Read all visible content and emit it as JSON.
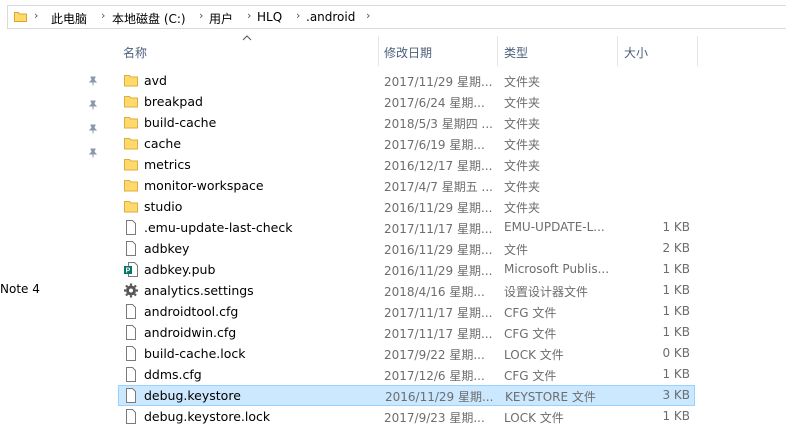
{
  "breadcrumb": [
    "此电脑",
    "本地磁盘 (C:)",
    "用户",
    "HLQ",
    ".android"
  ],
  "nav": {
    "partial_item": "Note 4"
  },
  "columns": {
    "name": "名称",
    "date": "修改日期",
    "type": "类型",
    "size": "大小"
  },
  "files": [
    {
      "name": "avd",
      "date": "2017/11/29 星期...",
      "type": "文件夹",
      "size": "",
      "icon": "folder-icon"
    },
    {
      "name": "breakpad",
      "date": "2017/6/24 星期...",
      "type": "文件夹",
      "size": "",
      "icon": "folder-icon"
    },
    {
      "name": "build-cache",
      "date": "2018/5/3 星期四 ...",
      "type": "文件夹",
      "size": "",
      "icon": "folder-icon"
    },
    {
      "name": "cache",
      "date": "2017/6/19 星期...",
      "type": "文件夹",
      "size": "",
      "icon": "folder-icon"
    },
    {
      "name": "metrics",
      "date": "2016/12/17 星期...",
      "type": "文件夹",
      "size": "",
      "icon": "folder-icon"
    },
    {
      "name": "monitor-workspace",
      "date": "2017/4/7 星期五 ...",
      "type": "文件夹",
      "size": "",
      "icon": "folder-icon"
    },
    {
      "name": "studio",
      "date": "2016/11/29 星期...",
      "type": "文件夹",
      "size": "",
      "icon": "folder-icon"
    },
    {
      "name": ".emu-update-last-check",
      "date": "2017/11/17 星期...",
      "type": "EMU-UPDATE-L...",
      "size": "1 KB",
      "icon": "file-icon"
    },
    {
      "name": "adbkey",
      "date": "2016/11/29 星期...",
      "type": "文件",
      "size": "2 KB",
      "icon": "file-icon"
    },
    {
      "name": "adbkey.pub",
      "date": "2016/11/29 星期...",
      "type": "Microsoft Publis...",
      "size": "1 KB",
      "icon": "publisher-icon"
    },
    {
      "name": "analytics.settings",
      "date": "2018/4/16 星期...",
      "type": "设置设计器文件",
      "size": "1 KB",
      "icon": "settings-gear-icon"
    },
    {
      "name": "androidtool.cfg",
      "date": "2017/11/17 星期...",
      "type": "CFG 文件",
      "size": "1 KB",
      "icon": "file-icon"
    },
    {
      "name": "androidwin.cfg",
      "date": "2017/11/17 星期...",
      "type": "CFG 文件",
      "size": "1 KB",
      "icon": "file-icon"
    },
    {
      "name": "build-cache.lock",
      "date": "2017/9/22 星期...",
      "type": "LOCK 文件",
      "size": "0 KB",
      "icon": "file-icon"
    },
    {
      "name": "ddms.cfg",
      "date": "2017/12/6 星期...",
      "type": "CFG 文件",
      "size": "1 KB",
      "icon": "file-icon"
    },
    {
      "name": "debug.keystore",
      "date": "2016/11/29 星期...",
      "type": "KEYSTORE 文件",
      "size": "3 KB",
      "icon": "file-icon",
      "selected": true
    },
    {
      "name": "debug.keystore.lock",
      "date": "2017/9/23 星期...",
      "type": "LOCK 文件",
      "size": "1 KB",
      "icon": "file-icon"
    }
  ],
  "colors": {
    "selection_bg": "#cce8ff",
    "selection_border": "#99d1ff",
    "folder_yellow": "#ffd96b",
    "header_text": "#4c607a"
  }
}
